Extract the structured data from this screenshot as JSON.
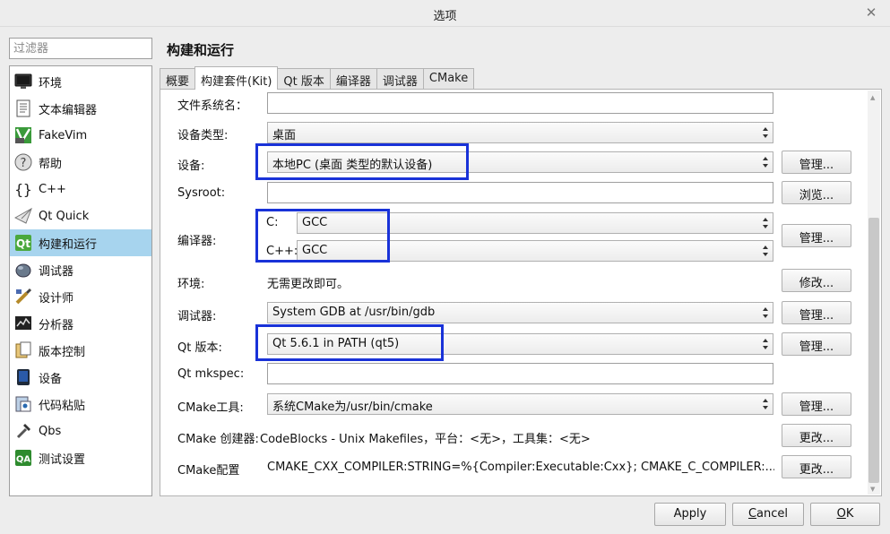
{
  "window": {
    "title": "选项"
  },
  "filter": {
    "placeholder": "过滤器"
  },
  "categories": [
    {
      "label": "环境",
      "icon": "monitor-icon"
    },
    {
      "label": "文本编辑器",
      "icon": "text-document-icon"
    },
    {
      "label": "FakeVim",
      "icon": "fakevim-icon"
    },
    {
      "label": "帮助",
      "icon": "help-icon"
    },
    {
      "label": "C++",
      "icon": "braces-icon"
    },
    {
      "label": "Qt Quick",
      "icon": "paper-plane-icon"
    },
    {
      "label": "构建和运行",
      "icon": "build-run-icon",
      "selected": true
    },
    {
      "label": "调试器",
      "icon": "debugger-icon"
    },
    {
      "label": "设计师",
      "icon": "designer-icon"
    },
    {
      "label": "分析器",
      "icon": "analyzer-icon"
    },
    {
      "label": "版本控制",
      "icon": "version-control-icon"
    },
    {
      "label": "设备",
      "icon": "device-icon"
    },
    {
      "label": "代码粘贴",
      "icon": "code-paste-icon"
    },
    {
      "label": "Qbs",
      "icon": "hammer-icon"
    },
    {
      "label": "测试设置",
      "icon": "qa-icon"
    }
  ],
  "page": {
    "title": "构建和运行"
  },
  "tabs": [
    {
      "label": "概要"
    },
    {
      "label": "构建套件(Kit)",
      "active": true
    },
    {
      "label": "Qt 版本"
    },
    {
      "label": "编译器"
    },
    {
      "label": "调试器"
    },
    {
      "label": "CMake"
    }
  ],
  "kit": {
    "filesystem_label": "文件系统名：",
    "filesystem_value": "",
    "device_type_label": "设备类型:",
    "device_type_value": "桌面",
    "device_label": "设备:",
    "device_value": "本地PC (桌面 类型的默认设备)",
    "device_button": "管理...",
    "sysroot_label": "Sysroot:",
    "sysroot_value": "",
    "sysroot_button": "浏览...",
    "compiler_label": "编译器:",
    "compiler_c_label": "C:",
    "compiler_c_value": "GCC",
    "compiler_cpp_label": "C++:",
    "compiler_cpp_value": "GCC",
    "compiler_button": "管理...",
    "env_label": "环境:",
    "env_value": "无需更改即可。",
    "env_button": "修改...",
    "debugger_label": "调试器:",
    "debugger_value": "System GDB at /usr/bin/gdb",
    "debugger_button": "管理...",
    "qt_label": "Qt 版本:",
    "qt_value": "Qt 5.6.1 in PATH (qt5)",
    "qt_button": "管理...",
    "mkspec_label": "Qt mkspec:",
    "mkspec_value": "",
    "cmake_tool_label": "CMake工具:",
    "cmake_tool_value": "系统CMake为/usr/bin/cmake",
    "cmake_tool_button": "管理...",
    "cmake_gen_label": "CMake 创建器:",
    "cmake_gen_value": "CodeBlocks - Unix Makefiles，平台：<无>，工具集：<无>",
    "cmake_gen_button": "更改...",
    "cmake_cfg_label": "CMake配置",
    "cmake_cfg_value": "CMAKE_CXX_COMPILER:STRING=%{Compiler:Executable:Cxx}; CMAKE_C_COMPILER:...",
    "cmake_cfg_button": "更改..."
  },
  "dialog": {
    "apply_label": "Apply",
    "cancel_mnemonic": "C",
    "cancel_rest": "ancel",
    "ok_mnemonic": "O",
    "ok_rest": "K"
  },
  "colors": {
    "selection": "#a7d4ee",
    "highlight_box": "#1932d8"
  }
}
